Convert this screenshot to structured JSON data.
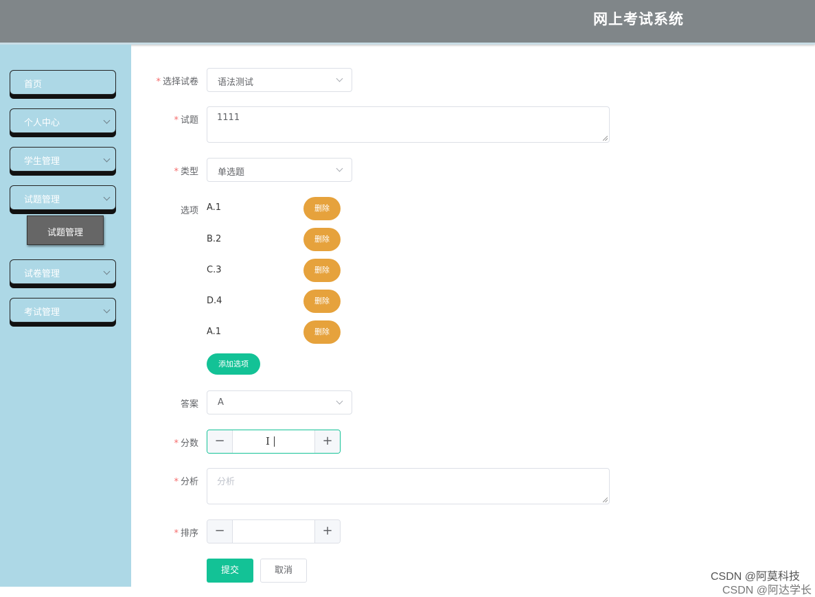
{
  "header": {
    "title": "网上考试系统"
  },
  "sidebar": {
    "items": [
      {
        "label": "首页",
        "has_submenu": false
      },
      {
        "label": "个人中心",
        "has_submenu": true
      },
      {
        "label": "学生管理",
        "has_submenu": true
      },
      {
        "label": "试题管理",
        "has_submenu": true,
        "expanded": true
      },
      {
        "label": "试卷管理",
        "has_submenu": true
      },
      {
        "label": "考试管理",
        "has_submenu": true
      }
    ],
    "active_submenu": {
      "label": "试题管理"
    }
  },
  "form": {
    "paper": {
      "label": "选择试卷",
      "required": true,
      "value": "语法测试"
    },
    "question": {
      "label": "试题",
      "required": true,
      "value": "1111"
    },
    "type": {
      "label": "类型",
      "required": true,
      "value": "单选题"
    },
    "options": {
      "label": "选项",
      "items": [
        "A.1",
        "B.2",
        "C.3",
        "D.4",
        "A.1"
      ],
      "delete_label": "删除",
      "add_label": "添加选项"
    },
    "answer": {
      "label": "答案",
      "required": false,
      "value": "A"
    },
    "score": {
      "label": "分数",
      "required": true,
      "value": "",
      "minus": "−",
      "plus": "+"
    },
    "analysis": {
      "label": "分析",
      "required": true,
      "placeholder": "分析"
    },
    "order": {
      "label": "排序",
      "required": true,
      "value": "",
      "minus": "−",
      "plus": "+"
    },
    "submit_label": "提交",
    "cancel_label": "取消"
  },
  "watermark": {
    "line1": "CSDN @阿莫科技",
    "line2": "CSDN @阿达学长"
  },
  "colors": {
    "header_bg": "#808689",
    "sidebar_bg": "#add8e6",
    "submenu_bg": "#666666",
    "primary": "#13c296",
    "warning": "#e6a23c",
    "required": "#f56c6c"
  }
}
